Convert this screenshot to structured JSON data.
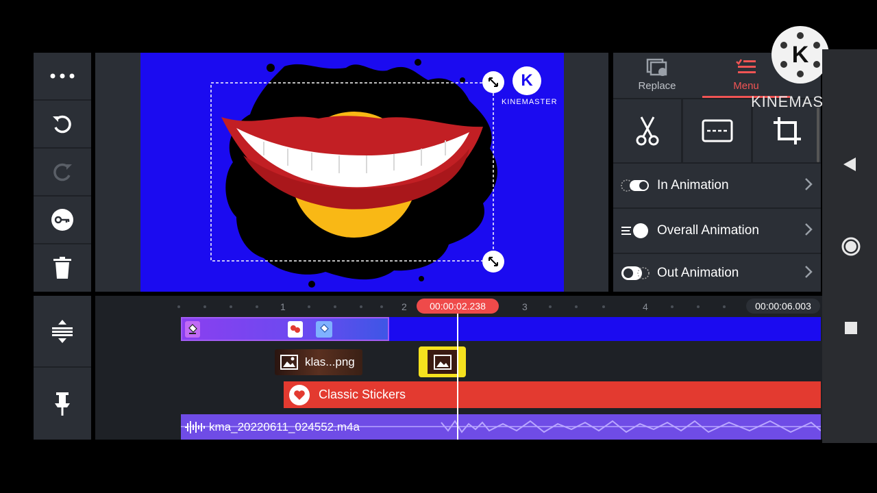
{
  "watermark": {
    "brand": "KINEMASTER",
    "logo_letter": "K"
  },
  "canvas": {
    "bg_color": "#1b0bf0",
    "sticker_brand": "KINEMASTER",
    "sticker_letter": "K"
  },
  "left_toolbar": {
    "items": [
      {
        "name": "more-icon"
      },
      {
        "name": "undo-icon"
      },
      {
        "name": "redo-icon"
      },
      {
        "name": "keyframe-icon"
      },
      {
        "name": "trash-icon"
      }
    ],
    "bottom": [
      {
        "name": "timeline-expand-icon"
      },
      {
        "name": "pin-icon"
      }
    ]
  },
  "right_panel": {
    "tabs": [
      {
        "label": "Replace",
        "icon": "replace-icon"
      },
      {
        "label": "Menu",
        "icon": "menu-icon",
        "active": true
      }
    ],
    "tools": [
      {
        "icon": "scissors-icon"
      },
      {
        "icon": "split-icon"
      },
      {
        "icon": "crop-icon"
      }
    ],
    "menu_items": [
      {
        "label": "In Animation",
        "icon": "in-animation-icon"
      },
      {
        "label": "Overall Animation",
        "icon": "overall-animation-icon"
      },
      {
        "label": "Out Animation",
        "icon": "out-animation-icon"
      }
    ],
    "accent": "#f05454"
  },
  "timeline": {
    "ruler_marks": [
      "1",
      "2",
      "3",
      "4"
    ],
    "playhead_time": "00:00:02.238",
    "total_time": "00:00:06.003",
    "layers": {
      "image_clip_label": "klas...png",
      "sticker_clip_label": "Classic Stickers",
      "audio_clip_label": "kma_20220611_024552.m4a"
    },
    "colors": {
      "video": "#1b0bf0",
      "effect": "#7a3ff0",
      "sticker": "#e33a30",
      "audio": "#7350e8",
      "playhead": "#ef4a4a"
    }
  },
  "system_nav": [
    {
      "icon": "back-icon"
    },
    {
      "icon": "home-icon"
    },
    {
      "icon": "recents-icon"
    }
  ]
}
